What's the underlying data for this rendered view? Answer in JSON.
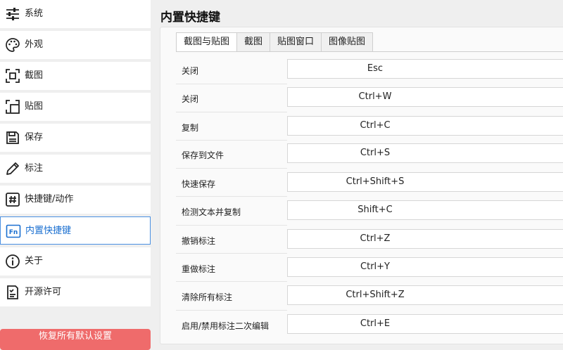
{
  "sidebar": {
    "items": [
      {
        "label": "系统",
        "icon": "sliders-icon"
      },
      {
        "label": "外观",
        "icon": "palette-icon"
      },
      {
        "label": "截图",
        "icon": "screenshot-frame-icon"
      },
      {
        "label": "贴图",
        "icon": "pin-image-icon"
      },
      {
        "label": "保存",
        "icon": "save-icon"
      },
      {
        "label": "标注",
        "icon": "pencil-icon"
      },
      {
        "label": "快捷键/动作",
        "icon": "hash-icon"
      },
      {
        "label": "内置快捷键",
        "icon": "fn-key-icon"
      },
      {
        "label": "关于",
        "icon": "info-icon"
      },
      {
        "label": "开源许可",
        "icon": "license-icon"
      }
    ],
    "active_label": "内置快捷键",
    "restore_label": "恢复所有默认设置"
  },
  "main": {
    "title": "内置快捷键",
    "tabs": [
      {
        "label": "截图与贴图"
      },
      {
        "label": "截图"
      },
      {
        "label": "贴图窗口"
      },
      {
        "label": "图像贴图"
      }
    ],
    "active_tab": "截图与贴图",
    "shortcuts": [
      {
        "label": "关闭",
        "keys": "Esc"
      },
      {
        "label": "关闭",
        "keys": "Ctrl+W"
      },
      {
        "label": "复制",
        "keys": "Ctrl+C"
      },
      {
        "label": "保存到文件",
        "keys": "Ctrl+S"
      },
      {
        "label": "快速保存",
        "keys": "Ctrl+Shift+S"
      },
      {
        "label": "检测文本并复制",
        "keys": "Shift+C"
      },
      {
        "label": "撤销标注",
        "keys": "Ctrl+Z"
      },
      {
        "label": "重做标注",
        "keys": "Ctrl+Y"
      },
      {
        "label": "清除所有标注",
        "keys": "Ctrl+Shift+Z"
      },
      {
        "label": "启用/禁用标注二次编辑",
        "keys": "Ctrl+E"
      }
    ]
  },
  "colors": {
    "accent": "#4a90e2",
    "danger": "#ef6b6b"
  }
}
